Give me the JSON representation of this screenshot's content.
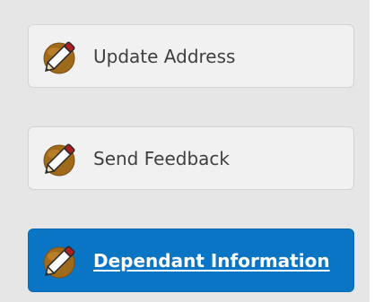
{
  "actions": [
    {
      "label": "Update Address",
      "icon": "pencil-icon",
      "state": "default"
    },
    {
      "label": "Send Feedback",
      "icon": "pencil-icon",
      "state": "default"
    },
    {
      "label": "Dependant Information",
      "icon": "pencil-icon",
      "state": "active"
    }
  ],
  "colors": {
    "panel_bg": "#e6e6e6",
    "button_bg": "#f1f1f1",
    "active_bg": "#0a75c4",
    "icon_circle": "#a06a1b",
    "label_text": "#3f3f3f"
  }
}
